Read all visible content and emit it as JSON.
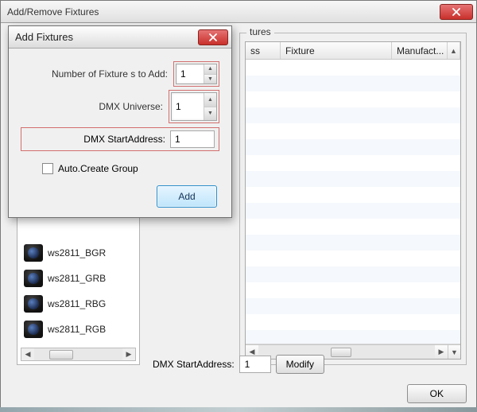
{
  "window": {
    "title": "Add/Remove Fixtures",
    "right_group_legend": "tures",
    "table": {
      "col_ss": "ss",
      "col_fixture": "Fixture",
      "col_manufacturer": "Manufact..."
    },
    "bottom": {
      "label": "DMX StartAddress:",
      "value": "1",
      "modify": "Modify"
    },
    "ok": "OK"
  },
  "left_list": {
    "items": [
      "ws2811_BGR",
      "ws2811_GRB",
      "ws2811_RBG",
      "ws2811_RGB"
    ]
  },
  "dialog": {
    "title": "Add Fixtures",
    "row_count_label": "Number of Fixture s to Add:",
    "row_count_value": "1",
    "row_univ_label": "DMX Universe:",
    "row_univ_value": "1",
    "row_addr_label": "DMX StartAddress:",
    "row_addr_value": "1",
    "auto_create": "Auto.Create Group",
    "add_btn": "Add"
  }
}
